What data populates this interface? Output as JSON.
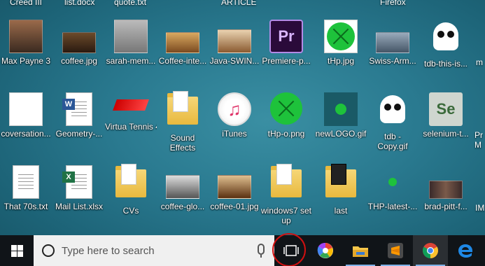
{
  "top_partial_labels": [
    "Creed III",
    "list.docx",
    "quote.txt",
    "ARTICLE",
    "Firefox"
  ],
  "rows": [
    [
      "Max Payne 3",
      "coffee.jpg",
      "sarah-mem...",
      "Coffee-inte...",
      "Java-SWIN...",
      "Premiere-p...",
      "tHp.jpg",
      "Swiss-Arm...",
      "tdb-this-is..."
    ],
    [
      "coversation...",
      "Geometry-...",
      "Virtua Tennis 4™",
      "Sound Effects",
      "iTunes",
      "tHp-o.png",
      "newLOGO.gif",
      "tdb - Copy.gif",
      "selenium-t..."
    ],
    [
      "That 70s.txt",
      "Mail List.xlsx",
      "CVs",
      "coffee-glo...",
      "coffee-01.jpg",
      "windows7 set up",
      "last",
      "THP-latest-...",
      "brad-pitt-f..."
    ]
  ],
  "right_edge_labels": [
    "m",
    "Pr M",
    "IM"
  ],
  "taskbar": {
    "search_placeholder": "Type here to search",
    "icons": [
      "windows-start-icon",
      "cortana-circle-icon",
      "microphone-icon",
      "task-view-icon",
      "picasa-icon",
      "file-explorer-icon",
      "sublime-text-icon",
      "chrome-icon",
      "edge-icon"
    ],
    "annotation_color": "#d01010"
  }
}
